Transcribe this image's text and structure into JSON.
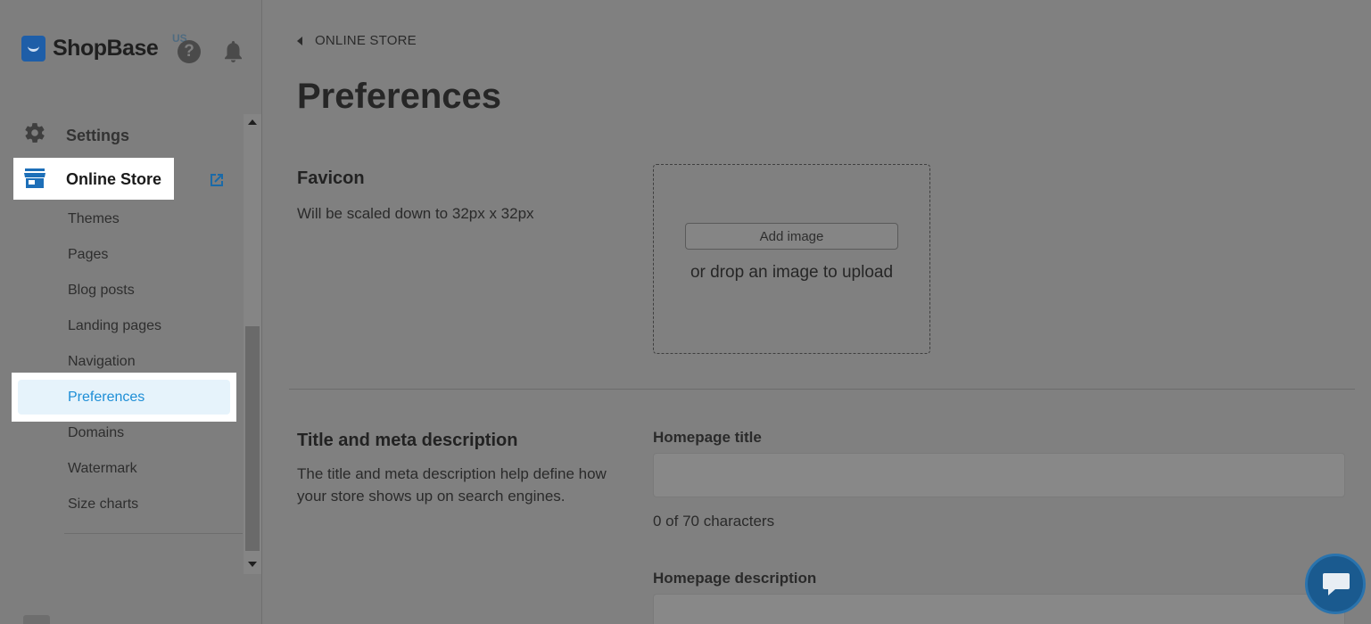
{
  "brand": {
    "name": "ShopBase",
    "region": "US"
  },
  "sidebar": {
    "settings_label": "Settings",
    "online_store_label": "Online Store",
    "items": [
      {
        "label": "Themes"
      },
      {
        "label": "Pages"
      },
      {
        "label": "Blog posts"
      },
      {
        "label": "Landing pages"
      },
      {
        "label": "Navigation"
      },
      {
        "label": "Preferences",
        "active": true
      },
      {
        "label": "Domains"
      },
      {
        "label": "Watermark"
      },
      {
        "label": "Size charts"
      }
    ]
  },
  "breadcrumb": {
    "label": "ONLINE STORE"
  },
  "page": {
    "title": "Preferences"
  },
  "favicon": {
    "title": "Favicon",
    "description": "Will be scaled down to 32px x 32px",
    "add_image_label": "Add image",
    "drop_hint": "or drop an image to upload"
  },
  "meta": {
    "title": "Title and meta description",
    "description": "The title and meta description help define how your store shows up on search engines.",
    "homepage_title_label": "Homepage title",
    "homepage_title_value": "",
    "char_count": "0 of 70 characters",
    "homepage_description_label": "Homepage description"
  },
  "colors": {
    "accent": "#1d8ed6",
    "brand": "#1e5ea8",
    "overlay": "#808080"
  },
  "icons": [
    "help-icon",
    "bell-icon",
    "gear-icon",
    "store-icon",
    "external-link-icon",
    "back-icon",
    "chat-icon"
  ]
}
